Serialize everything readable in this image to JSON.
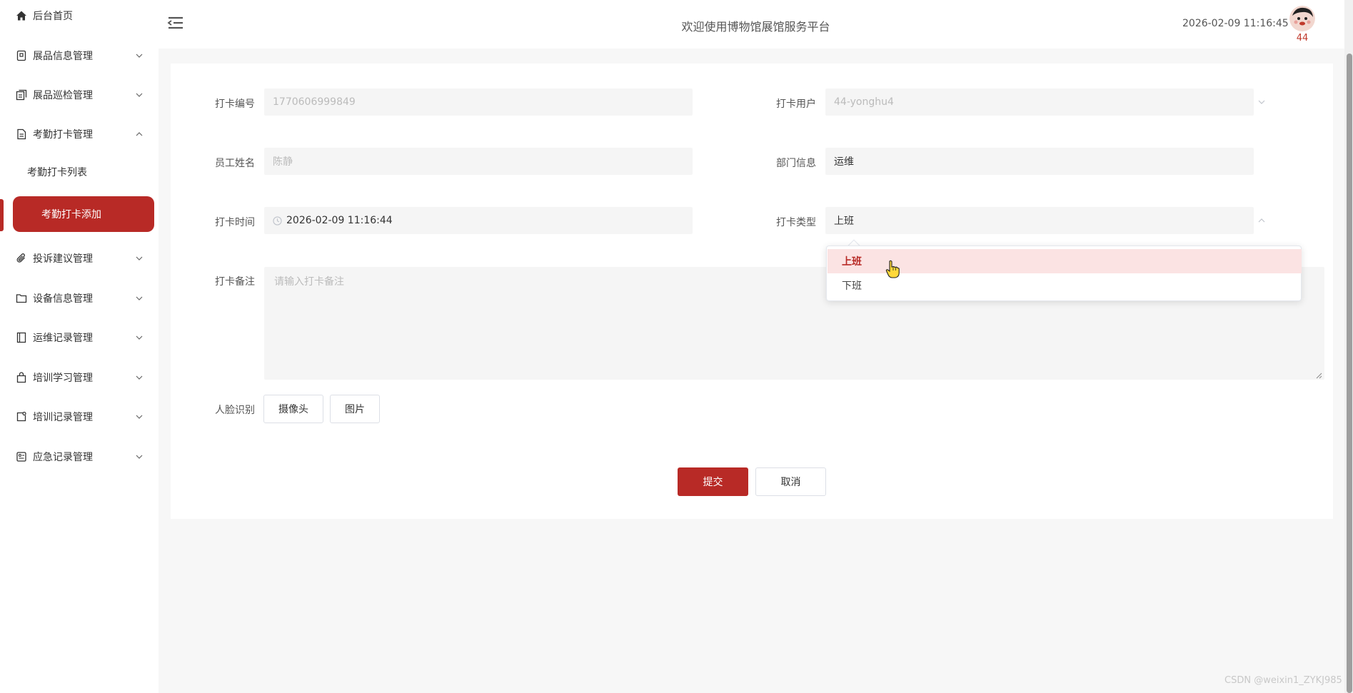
{
  "sidebar": {
    "home": {
      "label": "后台首页",
      "icon": "home-icon"
    },
    "items": [
      {
        "label": "展品信息管理",
        "icon": "exhibit-icon",
        "expanded": false
      },
      {
        "label": "展品巡检管理",
        "icon": "inspection-icon",
        "expanded": false
      },
      {
        "label": "考勤打卡管理",
        "icon": "document-icon",
        "expanded": true
      },
      {
        "label": "投诉建议管理",
        "icon": "paperclip-icon",
        "expanded": false
      },
      {
        "label": "设备信息管理",
        "icon": "folder-icon",
        "expanded": false
      },
      {
        "label": "运维记录管理",
        "icon": "notebook-icon",
        "expanded": false
      },
      {
        "label": "培训学习管理",
        "icon": "bag-icon",
        "expanded": false
      },
      {
        "label": "培训记录管理",
        "icon": "record-icon",
        "expanded": false
      },
      {
        "label": "应急记录管理",
        "icon": "emergency-icon",
        "expanded": false
      }
    ],
    "subitems": [
      {
        "label": "考勤打卡列表",
        "active": false
      },
      {
        "label": "考勤打卡添加",
        "active": true
      }
    ],
    "accent_color": "#b82a26"
  },
  "header": {
    "title": "欢迎使用博物馆展馆服务平台",
    "datetime": "2026-02-09 11:16:45",
    "username": "44"
  },
  "form": {
    "checkin_no": {
      "label": "打卡编号",
      "value": "1770606999849"
    },
    "checkin_user": {
      "label": "打卡用户",
      "value": "44-yonghu4"
    },
    "employee_name": {
      "label": "员工姓名",
      "value": "陈静"
    },
    "department": {
      "label": "部门信息",
      "value": "运维"
    },
    "checkin_time": {
      "label": "打卡时间",
      "value": "2026-02-09 11:16:44"
    },
    "checkin_type": {
      "label": "打卡类型",
      "value": "上班",
      "options": [
        "上班",
        "下班"
      ]
    },
    "remark": {
      "label": "打卡备注",
      "placeholder": "请输入打卡备注"
    },
    "face": {
      "label": "人脸识别",
      "camera_label": "摄像头",
      "image_label": "图片"
    },
    "submit_label": "提交",
    "cancel_label": "取消"
  },
  "watermark": "CSDN @weixin1_ZYKJ985"
}
